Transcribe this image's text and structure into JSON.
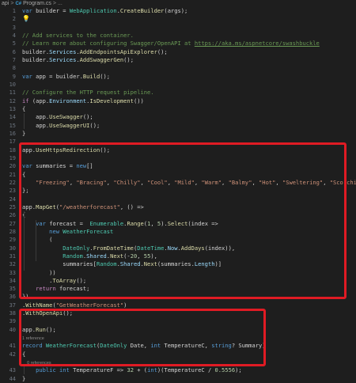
{
  "breadcrumb": {
    "project": "api",
    "sep": ">",
    "file_icon": "C#",
    "file": "Program.cs",
    "more": "> ..."
  },
  "gutter": [
    "1",
    "2",
    "3",
    "4",
    "5",
    "6",
    "7",
    "8",
    "9",
    "10",
    "11",
    "12",
    "13",
    "14",
    "15",
    "16",
    "17",
    "18",
    "19",
    "20",
    "21",
    "22",
    "23",
    "24",
    "25",
    "26",
    "27",
    "28",
    "29",
    "30",
    "31",
    "32",
    "33",
    "34",
    "35",
    "36",
    "37",
    "38",
    "39",
    "40",
    "",
    "41",
    "42",
    "",
    "43",
    "44"
  ],
  "code": [
    [
      [
        "var ",
        "k"
      ],
      [
        "builder = ",
        "d"
      ],
      [
        "WebApplication",
        "t"
      ],
      [
        ".",
        "d"
      ],
      [
        "CreateBuilder",
        "f"
      ],
      [
        "(args);",
        "d"
      ]
    ],
    [
      [
        "💡",
        "bulb"
      ]
    ],
    [],
    [
      [
        "// Add services to the container.",
        "c"
      ]
    ],
    [
      [
        "// Learn more about configuring Swagger/OpenAPI at ",
        "c"
      ],
      [
        "https://aka.ms/aspnetcore/swashbuckle",
        "u"
      ]
    ],
    [
      [
        "builder.",
        "d"
      ],
      [
        "Services",
        "p"
      ],
      [
        ".",
        "d"
      ],
      [
        "AddEndpointsApiExplorer",
        "f"
      ],
      [
        "();",
        "d"
      ]
    ],
    [
      [
        "builder.",
        "d"
      ],
      [
        "Services",
        "p"
      ],
      [
        ".",
        "d"
      ],
      [
        "AddSwaggerGen",
        "f"
      ],
      [
        "();",
        "d"
      ]
    ],
    [],
    [
      [
        "var ",
        "k"
      ],
      [
        "app = builder.",
        "d"
      ],
      [
        "Build",
        "f"
      ],
      [
        "();",
        "d"
      ]
    ],
    [],
    [
      [
        "// Configure the HTTP request pipeline.",
        "c"
      ]
    ],
    [
      [
        "if ",
        "kc"
      ],
      [
        "(app.",
        "d"
      ],
      [
        "Environment",
        "p"
      ],
      [
        ".",
        "d"
      ],
      [
        "IsDevelopment",
        "f"
      ],
      [
        "())",
        "d"
      ]
    ],
    [
      [
        "{",
        "d"
      ]
    ],
    [
      [
        "    app.",
        "d"
      ],
      [
        "UseSwagger",
        "f"
      ],
      [
        "();",
        "d"
      ]
    ],
    [
      [
        "    app.",
        "d"
      ],
      [
        "UseSwaggerUI",
        "f"
      ],
      [
        "();",
        "d"
      ]
    ],
    [
      [
        "}",
        "d"
      ]
    ],
    [],
    [
      [
        "app.",
        "d"
      ],
      [
        "UseHttpsRedirection",
        "f"
      ],
      [
        "();",
        "d"
      ]
    ],
    [],
    [
      [
        "var ",
        "k"
      ],
      [
        "summaries = ",
        "d"
      ],
      [
        "new",
        "k"
      ],
      [
        "[]",
        "d"
      ]
    ],
    [
      [
        "{",
        "d"
      ]
    ],
    [
      [
        "    ",
        "d"
      ],
      [
        "\"Freezing\"",
        "s"
      ],
      [
        ", ",
        "d"
      ],
      [
        "\"Bracing\"",
        "s"
      ],
      [
        ", ",
        "d"
      ],
      [
        "\"Chilly\"",
        "s"
      ],
      [
        ", ",
        "d"
      ],
      [
        "\"Cool\"",
        "s"
      ],
      [
        ", ",
        "d"
      ],
      [
        "\"Mild\"",
        "s"
      ],
      [
        ", ",
        "d"
      ],
      [
        "\"Warm\"",
        "s"
      ],
      [
        ", ",
        "d"
      ],
      [
        "\"Balmy\"",
        "s"
      ],
      [
        ", ",
        "d"
      ],
      [
        "\"Hot\"",
        "s"
      ],
      [
        ", ",
        "d"
      ],
      [
        "\"Sweltering\"",
        "s"
      ],
      [
        ", ",
        "d"
      ],
      [
        "\"Scorching\"",
        "s"
      ]
    ],
    [
      [
        "};",
        "d"
      ]
    ],
    [],
    [
      [
        "app.",
        "d"
      ],
      [
        "MapGet",
        "f"
      ],
      [
        "(",
        "d"
      ],
      [
        "\"/weatherforecast\"",
        "s"
      ],
      [
        ", () =>",
        "d"
      ]
    ],
    [
      [
        "{",
        "d"
      ]
    ],
    [
      [
        "    ",
        "d"
      ],
      [
        "var ",
        "k"
      ],
      [
        "forecast =  ",
        "d"
      ],
      [
        "Enumerable",
        "t"
      ],
      [
        ".",
        "d"
      ],
      [
        "Range",
        "f"
      ],
      [
        "(",
        "d"
      ],
      [
        "1",
        "n"
      ],
      [
        ", ",
        "d"
      ],
      [
        "5",
        "n"
      ],
      [
        ").",
        "d"
      ],
      [
        "Select",
        "f"
      ],
      [
        "(index =>",
        "d"
      ]
    ],
    [
      [
        "        ",
        "d"
      ],
      [
        "new ",
        "k"
      ],
      [
        "WeatherForecast",
        "t"
      ]
    ],
    [
      [
        "        (",
        "d"
      ]
    ],
    [
      [
        "            ",
        "d"
      ],
      [
        "DateOnly",
        "t"
      ],
      [
        ".",
        "d"
      ],
      [
        "FromDateTime",
        "f"
      ],
      [
        "(",
        "d"
      ],
      [
        "DateTime",
        "t"
      ],
      [
        ".",
        "d"
      ],
      [
        "Now",
        "p"
      ],
      [
        ".",
        "d"
      ],
      [
        "AddDays",
        "f"
      ],
      [
        "(index)),",
        "d"
      ]
    ],
    [
      [
        "            ",
        "d"
      ],
      [
        "Random",
        "t"
      ],
      [
        ".",
        "d"
      ],
      [
        "Shared",
        "p"
      ],
      [
        ".",
        "d"
      ],
      [
        "Next",
        "f"
      ],
      [
        "(-",
        "d"
      ],
      [
        "20",
        "n"
      ],
      [
        ", ",
        "d"
      ],
      [
        "55",
        "n"
      ],
      [
        "),",
        "d"
      ]
    ],
    [
      [
        "            summaries[",
        "d"
      ],
      [
        "Random",
        "t"
      ],
      [
        ".",
        "d"
      ],
      [
        "Shared",
        "p"
      ],
      [
        ".",
        "d"
      ],
      [
        "Next",
        "f"
      ],
      [
        "(summaries.",
        "d"
      ],
      [
        "Length",
        "p"
      ],
      [
        ")]",
        "d"
      ]
    ],
    [
      [
        "        ))",
        "d"
      ]
    ],
    [
      [
        "        .",
        "d"
      ],
      [
        "ToArray",
        "f"
      ],
      [
        "();",
        "d"
      ]
    ],
    [
      [
        "    ",
        "d"
      ],
      [
        "return ",
        "kc"
      ],
      [
        "forecast;",
        "d"
      ]
    ],
    [
      [
        "})",
        "d"
      ]
    ],
    [
      [
        ".",
        "d"
      ],
      [
        "WithName",
        "f"
      ],
      [
        "(",
        "d"
      ],
      [
        "\"GetWeatherForecast\"",
        "s"
      ],
      [
        ")",
        "d"
      ]
    ],
    [
      [
        ".",
        "d"
      ],
      [
        "WithOpenApi",
        "f"
      ],
      [
        "();",
        "d"
      ]
    ],
    [],
    [
      [
        "app.",
        "d"
      ],
      [
        "Run",
        "f"
      ],
      [
        "();",
        "d"
      ]
    ],
    [
      [
        "1 reference",
        "lens"
      ]
    ],
    [
      [
        "record ",
        "k"
      ],
      [
        "WeatherForecast",
        "t"
      ],
      [
        "(",
        "d"
      ],
      [
        "DateOnly ",
        "t"
      ],
      [
        "Date, ",
        "d"
      ],
      [
        "int ",
        "k"
      ],
      [
        "TemperatureC, ",
        "d"
      ],
      [
        "string",
        "k"
      ],
      [
        "? Summary)",
        "d"
      ]
    ],
    [
      [
        "{",
        "d"
      ]
    ],
    [
      [
        "    0 references",
        "lens"
      ]
    ],
    [
      [
        "    ",
        "d"
      ],
      [
        "public ",
        "k"
      ],
      [
        "int ",
        "k"
      ],
      [
        "TemperatureF => ",
        "d"
      ],
      [
        "32",
        "n"
      ],
      [
        " + (",
        "d"
      ],
      [
        "int",
        "k"
      ],
      [
        ")(TemperatureC / ",
        "d"
      ],
      [
        "0.5556",
        "n"
      ],
      [
        ");",
        "d"
      ]
    ],
    [
      [
        "}",
        "d"
      ]
    ]
  ],
  "highlight_colors": {
    "box": "#e01b24"
  }
}
